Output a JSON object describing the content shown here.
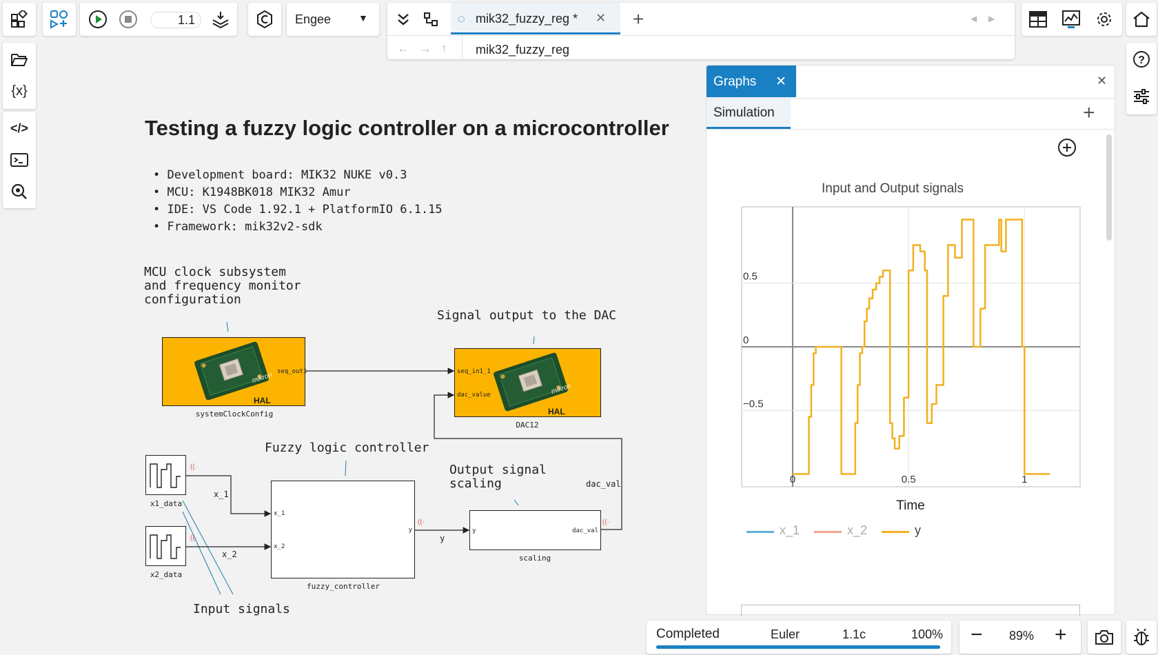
{
  "toolbar": {
    "sim_time": "1.1",
    "solver_select": "Engee",
    "tab_title": "mik32_fuzzy_reg *",
    "path": "mik32_fuzzy_reg"
  },
  "canvas": {
    "title": "Testing a fuzzy logic controller on a microcontroller",
    "bullets": [
      "Development board: MIK32 NUKE v0.3",
      "MCU: K1948BK018 MIK32 Amur",
      "IDE: VS Code 1.92.1 + PlatformIO 6.1.15",
      "Framework: mik32v2-sdk"
    ],
    "annotations": {
      "clock": "MCU clock subsystem\nand frequency monitor\nconfiguration",
      "dac": "Signal output to the DAC",
      "fuzzy": "Fuzzy logic controller",
      "scaling": "Output signal\nscaling",
      "inputs": "Input signals"
    },
    "blocks": {
      "sys_clock": {
        "label": "systemClockConfig",
        "port_out": "seq_out1",
        "badge": "HAL",
        "chip_text": "mikron"
      },
      "dac": {
        "label": "DAC12",
        "port_in1": "seq_in1_1",
        "port_in2": "dac_value",
        "badge": "HAL",
        "chip_text": "mikron"
      },
      "x1": {
        "label": "x1_data"
      },
      "x2": {
        "label": "x2_data"
      },
      "fuzzy": {
        "label": "fuzzy_controller",
        "port_in1": "x_1",
        "port_in2": "x_2",
        "port_out": "y"
      },
      "scaling": {
        "label": "scaling",
        "port_in": "y",
        "port_out": "dac_val"
      }
    },
    "signals": {
      "x1": "x_1",
      "x2": "x_2",
      "y": "y",
      "dac_val": "dac_val"
    }
  },
  "graphs": {
    "tab_label": "Graphs",
    "subtab_label": "Simulation",
    "plot_title": "Input and Output signals",
    "xlabel": "Time"
  },
  "chart_data": {
    "type": "line",
    "title": "Input and Output signals",
    "xlabel": "Time",
    "ylabel": "",
    "xlim": [
      -0.22,
      1.24
    ],
    "ylim": [
      -1.1,
      1.1
    ],
    "x_ticks": [
      0,
      0.5,
      1
    ],
    "y_ticks": [
      -0.5,
      0,
      0.5
    ],
    "grid": true,
    "legend_position": "bottom",
    "series": [
      {
        "name": "x_1",
        "color": "#5ab4d8",
        "x": [],
        "y": []
      },
      {
        "name": "x_2",
        "color": "#f0a48c",
        "x": [],
        "y": []
      },
      {
        "name": "y",
        "color": "#f2b01e",
        "x": [
          0,
          0.07,
          0.07,
          0.08,
          0.08,
          0.09,
          0.09,
          0.1,
          0.1,
          0.11,
          0.11,
          0.21,
          0.21,
          0.27,
          0.27,
          0.28,
          0.28,
          0.29,
          0.29,
          0.3,
          0.3,
          0.31,
          0.31,
          0.32,
          0.32,
          0.33,
          0.33,
          0.345,
          0.345,
          0.36,
          0.36,
          0.375,
          0.375,
          0.39,
          0.39,
          0.405,
          0.405,
          0.42,
          0.42,
          0.43,
          0.43,
          0.44,
          0.44,
          0.46,
          0.46,
          0.48,
          0.48,
          0.5,
          0.5,
          0.52,
          0.52,
          0.55,
          0.55,
          0.57,
          0.57,
          0.58,
          0.58,
          0.6,
          0.6,
          0.62,
          0.62,
          0.65,
          0.65,
          0.67,
          0.67,
          0.7,
          0.7,
          0.73,
          0.73,
          0.75,
          0.75,
          0.77,
          0.77,
          0.78,
          0.78,
          0.79,
          0.79,
          0.8,
          0.8,
          0.81,
          0.81,
          0.83,
          0.83,
          0.89,
          0.89,
          0.9,
          0.9,
          0.91,
          0.91,
          0.92,
          0.92,
          0.94,
          0.94,
          0.97,
          0.97,
          0.98,
          0.98,
          0.99,
          0.99,
          1.0,
          1.0,
          1.02,
          1.02,
          1.07,
          1.07,
          1.08,
          1.08,
          1.11
        ],
        "y": [
          -1,
          -1,
          -0.55,
          -0.55,
          -0.3,
          -0.3,
          -0.05,
          -0.05,
          0,
          0,
          0,
          0,
          -1,
          -1,
          -0.6,
          -0.6,
          -0.3,
          -0.3,
          -0.05,
          -0.05,
          0,
          0,
          0.2,
          0.2,
          0.3,
          0.3,
          0.38,
          0.38,
          0.45,
          0.45,
          0.5,
          0.5,
          0.55,
          0.55,
          0.6,
          0.6,
          0.6,
          0.6,
          -0.6,
          -0.6,
          -0.72,
          -0.72,
          -0.8,
          -0.8,
          -0.7,
          -0.7,
          -0.4,
          -0.4,
          0.6,
          0.6,
          0.8,
          0.8,
          0.75,
          0.75,
          0.6,
          0.6,
          -0.6,
          -0.6,
          -0.45,
          -0.45,
          -0.3,
          -0.3,
          0.4,
          0.4,
          0.8,
          0.8,
          0.7,
          0.7,
          1,
          1,
          1,
          1,
          1,
          1,
          0,
          0,
          0,
          0,
          0,
          0,
          0.3,
          0.3,
          0.8,
          0.8,
          1,
          1,
          0.75,
          0.75,
          0.75,
          0.75,
          1,
          1,
          1,
          1,
          1,
          1,
          1,
          1,
          0,
          0,
          -1,
          -1,
          -1,
          -1,
          -1,
          -1,
          -1,
          -1
        ]
      }
    ]
  },
  "status": {
    "state": "Completed",
    "solver": "Euler",
    "time": "1.1c",
    "percent": "100%",
    "zoom": "89%",
    "progress": 1.0
  }
}
